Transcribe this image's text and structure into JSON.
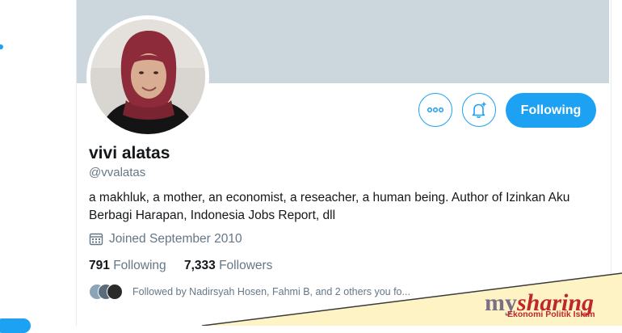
{
  "profile": {
    "name": "vivi alatas",
    "handle": "@vvalatas",
    "bio": "a makhluk, a mother, an economist, a reseacher, a human being.  Author of Izinkan Aku Berbagi Harapan, Indonesia Jobs Report, dll",
    "joined": "Joined September 2010",
    "following_count": "791",
    "following_label": "Following",
    "followers_count": "7,333",
    "followers_label": "Followers",
    "followed_by": "Followed by Nadirsyah Hosen, Fahmi B, and 2 others you fo..."
  },
  "actions": {
    "more_icon": "more-icon",
    "notify_icon": "bell-plus-icon",
    "follow_label": "Following"
  },
  "watermark": {
    "brand_prefix": "my",
    "brand_main": "sharing",
    "subtitle": "Ekonomi Politik Islam"
  },
  "colors": {
    "accent": "#1da1f2",
    "banner": "#ccd6dd",
    "watermark_bg": "#fdf3c4",
    "watermark_red": "#c0272d"
  }
}
